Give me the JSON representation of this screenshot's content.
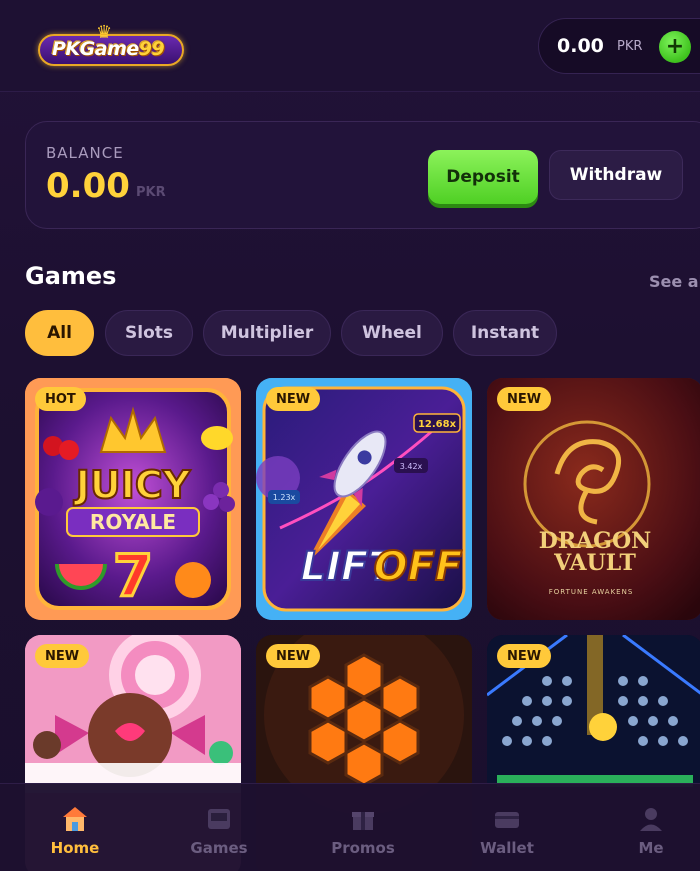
{
  "header": {
    "logo_text_main": "PKGame",
    "logo_text_accent": "99",
    "wallet": {
      "amount": "0.00",
      "currency": "PKR",
      "add_label": "+"
    }
  },
  "balance": {
    "label": "BALANCE",
    "amount": "0.00",
    "currency": "PKR",
    "deposit_label": "Deposit",
    "withdraw_label": "Withdraw"
  },
  "games": {
    "title": "Games",
    "see_all": "See all",
    "filters": [
      {
        "label": "All",
        "active": true
      },
      {
        "label": "Slots",
        "active": false
      },
      {
        "label": "Multiplier",
        "active": false
      },
      {
        "label": "Wheel",
        "active": false
      },
      {
        "label": "Instant",
        "active": false
      }
    ],
    "tiles": [
      {
        "badge": "HOT",
        "art_line1": "JUICY",
        "art_line2": "ROYALE",
        "art_line3": "7"
      },
      {
        "badge": "NEW",
        "art_line1": "LIFT",
        "art_line2": "OFF",
        "mult1": "12.68x",
        "mult2": "3.42x",
        "mult3": "1.23x"
      },
      {
        "badge": "NEW",
        "art_line1": "DRAGON",
        "art_line2": "VAULT",
        "art_line3": "FORTUNE AWAKENS"
      },
      {
        "badge": "NEW"
      },
      {
        "badge": "NEW"
      },
      {
        "badge": "NEW"
      }
    ]
  },
  "nav": [
    {
      "label": "Home",
      "icon": "home-icon",
      "active": true
    },
    {
      "label": "Games",
      "icon": "games-icon",
      "active": false
    },
    {
      "label": "Promos",
      "icon": "gift-icon",
      "active": false
    },
    {
      "label": "Wallet",
      "icon": "wallet-icon",
      "active": false
    },
    {
      "label": "Me",
      "icon": "user-icon",
      "active": false
    }
  ],
  "colors": {
    "accent": "#ffbe3d",
    "gold": "#ffd23a",
    "deposit_green": "#5fd42e",
    "background": "#1d1031"
  }
}
